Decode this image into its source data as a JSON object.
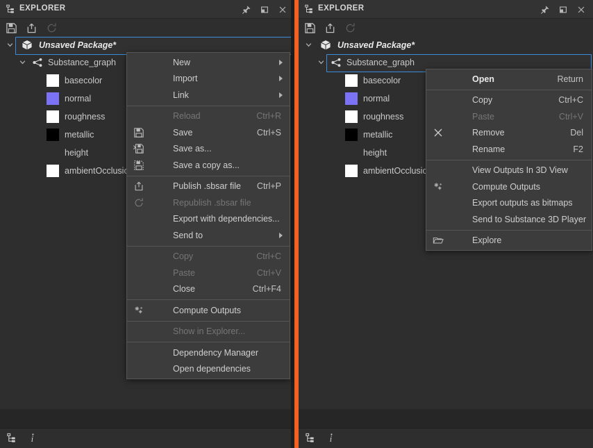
{
  "colors": {
    "divider_orange": "#f26122",
    "selection_border": "#3c8edc",
    "panel_bg": "#2e2e2e",
    "titlebar_bg": "#333333",
    "menu_bg": "#3c3c3c",
    "menu_border": "#565656",
    "text": "#c8c8c8",
    "text_disabled": "#767676",
    "swatch_white": "#ffffff",
    "swatch_normal": "#7b72f5",
    "swatch_black": "#000000"
  },
  "panels": [
    {
      "id": "left",
      "titlebar": {
        "title": "EXPLORER",
        "icon": "explorer-tree-icon",
        "buttons": [
          {
            "name": "pin-icon",
            "label": "Pin"
          },
          {
            "name": "maximize-icon",
            "label": "Maximize"
          },
          {
            "name": "close-icon",
            "label": "Close"
          }
        ]
      },
      "toolbar": [
        {
          "name": "save-icon",
          "label": "Save",
          "disabled": false
        },
        {
          "name": "publish-icon",
          "label": "Publish .sbsar file",
          "disabled": false
        },
        {
          "name": "republish-icon",
          "label": "Republish .sbsar file",
          "disabled": true
        }
      ],
      "tree": {
        "package": {
          "label": "Unsaved Package*",
          "icon": "package-icon",
          "expanded": true,
          "selected": true
        },
        "graph": {
          "label": "Substance_graph",
          "icon": "graph-icon",
          "expanded": true,
          "selected": false
        },
        "outputs": [
          {
            "label": "basecolor",
            "swatch": "#ffffff"
          },
          {
            "label": "normal",
            "swatch": "#7b72f5"
          },
          {
            "label": "roughness",
            "swatch": "#ffffff"
          },
          {
            "label": "metallic",
            "swatch": "#000000"
          },
          {
            "label": "height",
            "swatch": null
          },
          {
            "label": "ambientOcclusion",
            "swatch": "#ffffff"
          }
        ]
      },
      "statusbar": [
        {
          "name": "explorer-tree-icon",
          "label": "Explorer tree"
        },
        {
          "name": "info-icon",
          "label": "Info"
        }
      ]
    },
    {
      "id": "right",
      "titlebar": {
        "title": "EXPLORER",
        "icon": "explorer-tree-icon",
        "buttons": [
          {
            "name": "pin-icon",
            "label": "Pin"
          },
          {
            "name": "maximize-icon",
            "label": "Maximize"
          },
          {
            "name": "close-icon",
            "label": "Close"
          }
        ]
      },
      "toolbar": [
        {
          "name": "save-icon",
          "label": "Save",
          "disabled": false
        },
        {
          "name": "publish-icon",
          "label": "Publish .sbsar file",
          "disabled": false
        },
        {
          "name": "republish-icon",
          "label": "Republish .sbsar file",
          "disabled": true
        }
      ],
      "tree": {
        "package": {
          "label": "Unsaved Package*",
          "icon": "package-icon",
          "expanded": true,
          "selected": false
        },
        "graph": {
          "label": "Substance_graph",
          "icon": "graph-icon",
          "expanded": true,
          "selected": true
        },
        "outputs": [
          {
            "label": "basecolor",
            "swatch": "#ffffff"
          },
          {
            "label": "normal",
            "swatch": "#7b72f5"
          },
          {
            "label": "roughness",
            "swatch": "#ffffff"
          },
          {
            "label": "metallic",
            "swatch": "#000000"
          },
          {
            "label": "height",
            "swatch": null
          },
          {
            "label": "ambientOcclusion",
            "swatch": "#ffffff"
          }
        ]
      },
      "statusbar": [
        {
          "name": "explorer-tree-icon",
          "label": "Explorer tree"
        },
        {
          "name": "info-icon",
          "label": "Info"
        }
      ]
    }
  ],
  "package_context_menu": {
    "items": [
      {
        "type": "item",
        "label": "New",
        "shortcut": "",
        "icon": null,
        "submenu": true,
        "disabled": false
      },
      {
        "type": "item",
        "label": "Import",
        "shortcut": "",
        "icon": null,
        "submenu": true,
        "disabled": false
      },
      {
        "type": "item",
        "label": "Link",
        "shortcut": "",
        "icon": null,
        "submenu": true,
        "disabled": false
      },
      {
        "type": "separator"
      },
      {
        "type": "item",
        "label": "Reload",
        "shortcut": "Ctrl+R",
        "icon": null,
        "submenu": false,
        "disabled": true
      },
      {
        "type": "item",
        "label": "Save",
        "shortcut": "Ctrl+S",
        "icon": "save-icon",
        "submenu": false,
        "disabled": false
      },
      {
        "type": "item",
        "label": "Save as...",
        "shortcut": "",
        "icon": "save-as-icon",
        "submenu": false,
        "disabled": false
      },
      {
        "type": "item",
        "label": "Save a copy as...",
        "shortcut": "",
        "icon": "save-copy-icon",
        "submenu": false,
        "disabled": false
      },
      {
        "type": "separator"
      },
      {
        "type": "item",
        "label": "Publish .sbsar file",
        "shortcut": "Ctrl+P",
        "icon": "publish-icon",
        "submenu": false,
        "disabled": false
      },
      {
        "type": "item",
        "label": "Republish .sbsar file",
        "shortcut": "",
        "icon": "republish-icon",
        "submenu": false,
        "disabled": true
      },
      {
        "type": "item",
        "label": "Export with dependencies...",
        "shortcut": "",
        "icon": null,
        "submenu": false,
        "disabled": false
      },
      {
        "type": "item",
        "label": "Send to",
        "shortcut": "",
        "icon": null,
        "submenu": true,
        "disabled": false
      },
      {
        "type": "separator"
      },
      {
        "type": "item",
        "label": "Copy",
        "shortcut": "Ctrl+C",
        "icon": null,
        "submenu": false,
        "disabled": true
      },
      {
        "type": "item",
        "label": "Paste",
        "shortcut": "Ctrl+V",
        "icon": null,
        "submenu": false,
        "disabled": true
      },
      {
        "type": "item",
        "label": "Close",
        "shortcut": "Ctrl+F4",
        "icon": null,
        "submenu": false,
        "disabled": false
      },
      {
        "type": "separator"
      },
      {
        "type": "item",
        "label": "Compute Outputs",
        "shortcut": "",
        "icon": "compute-icon",
        "submenu": false,
        "disabled": false
      },
      {
        "type": "separator"
      },
      {
        "type": "item",
        "label": "Show in Explorer...",
        "shortcut": "",
        "icon": null,
        "submenu": false,
        "disabled": true
      },
      {
        "type": "separator"
      },
      {
        "type": "item",
        "label": "Dependency Manager",
        "shortcut": "",
        "icon": null,
        "submenu": false,
        "disabled": false
      },
      {
        "type": "item",
        "label": "Open dependencies",
        "shortcut": "",
        "icon": null,
        "submenu": false,
        "disabled": false
      }
    ]
  },
  "graph_context_menu": {
    "items": [
      {
        "type": "item",
        "label": "Open",
        "shortcut": "Return",
        "icon": null,
        "submenu": false,
        "disabled": false,
        "bold": true
      },
      {
        "type": "separator"
      },
      {
        "type": "item",
        "label": "Copy",
        "shortcut": "Ctrl+C",
        "icon": null,
        "submenu": false,
        "disabled": false
      },
      {
        "type": "item",
        "label": "Paste",
        "shortcut": "Ctrl+V",
        "icon": null,
        "submenu": false,
        "disabled": true
      },
      {
        "type": "item",
        "label": "Remove",
        "shortcut": "Del",
        "icon": "remove-icon",
        "submenu": false,
        "disabled": false
      },
      {
        "type": "item",
        "label": "Rename",
        "shortcut": "F2",
        "icon": null,
        "submenu": false,
        "disabled": false
      },
      {
        "type": "separator"
      },
      {
        "type": "item",
        "label": "View Outputs In 3D View",
        "shortcut": "",
        "icon": null,
        "submenu": false,
        "disabled": false
      },
      {
        "type": "item",
        "label": "Compute Outputs",
        "shortcut": "",
        "icon": "compute-icon",
        "submenu": false,
        "disabled": false
      },
      {
        "type": "item",
        "label": "Export outputs as bitmaps",
        "shortcut": "",
        "icon": null,
        "submenu": false,
        "disabled": false
      },
      {
        "type": "item",
        "label": "Send to Substance 3D Player",
        "shortcut": "",
        "icon": null,
        "submenu": false,
        "disabled": false
      },
      {
        "type": "separator"
      },
      {
        "type": "item",
        "label": "Explore",
        "shortcut": "",
        "icon": "folder-icon",
        "submenu": false,
        "disabled": false
      }
    ]
  }
}
